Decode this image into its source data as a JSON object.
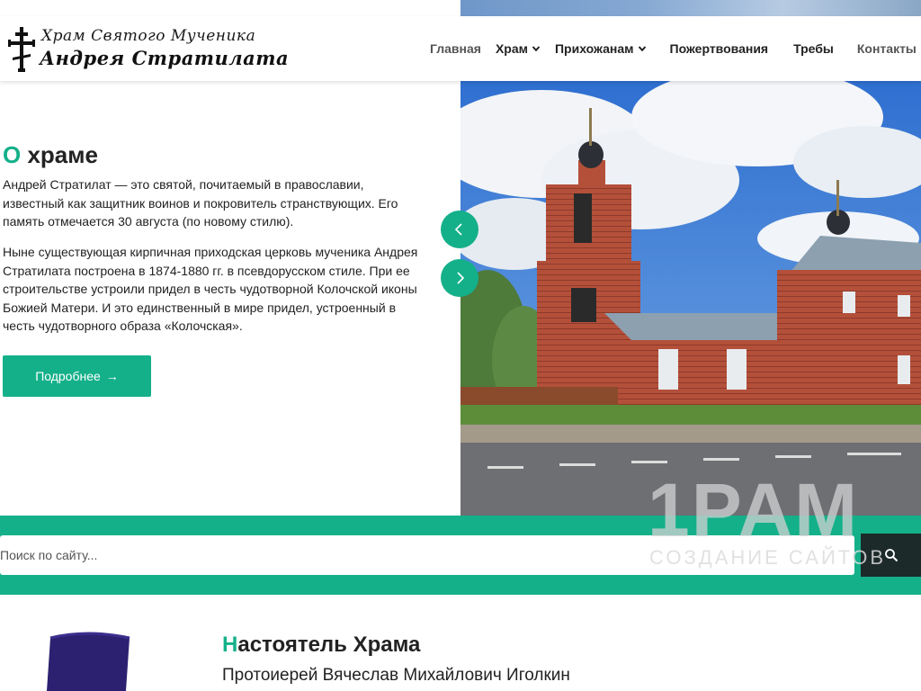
{
  "header": {
    "logo_line1": "Храм Святого Мученика",
    "logo_line2": "Андрея Стратилата",
    "nav": {
      "home": "Главная",
      "temple": "Храм",
      "parishioners": "Прихожанам",
      "donations": "Пожертвования",
      "services": "Требы",
      "contacts": "Контакты"
    }
  },
  "hero": {
    "title_first": "О",
    "title_rest": " храме",
    "paragraph1": "Андрей Стратилат — это святой, почитаемый в православии, известный как защитник воинов и покровитель странствующих. Его память отмечается 30 августа (по новому стилю).",
    "paragraph2": "Ныне существующая кирпичная приходская церковь мученика Андрея Стратилата построена в 1874-1880 гг. в псевдорусском стиле. При ее строительстве устроили придел в честь чудотворной Колочской иконы Божией Матери. И это единственный в мире придел, устроенный в честь чудотворного образа «Колочская».",
    "more_label": "Подробнее",
    "more_arrow": "→"
  },
  "search": {
    "placeholder": "Поиск по сайту..."
  },
  "watermark": {
    "big": "1PAM",
    "small": "СОЗДАНИЕ САЙТОВ"
  },
  "rector": {
    "title_first": "Н",
    "title_rest": "астоятель Храма",
    "name": "Протоиерей Вячеслав Михайлович Иголкин"
  },
  "colors": {
    "accent": "#14b08a",
    "dark": "#1d2a2a"
  },
  "icons": {
    "logo": "orthodox-cross-icon",
    "nav_dropdown": "chevron-down-icon",
    "slider_prev": "chevron-left-icon",
    "slider_next": "chevron-right-icon",
    "search": "search-icon"
  }
}
